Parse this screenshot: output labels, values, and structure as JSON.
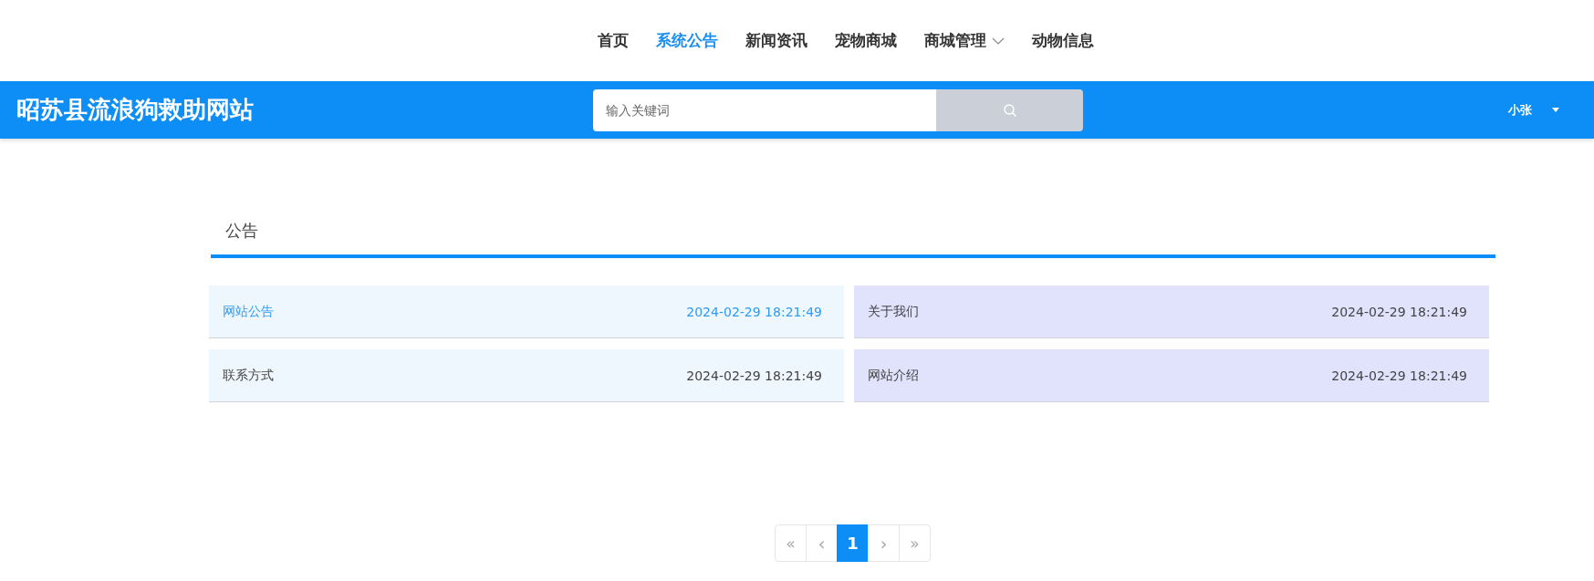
{
  "nav": [
    {
      "label": "首页",
      "selected": false,
      "dropdown": false
    },
    {
      "label": "系统公告",
      "selected": true,
      "dropdown": false
    },
    {
      "label": "新闻资讯",
      "selected": false,
      "dropdown": false
    },
    {
      "label": "宠物商城",
      "selected": false,
      "dropdown": false
    },
    {
      "label": "商城管理",
      "selected": false,
      "dropdown": true
    },
    {
      "label": "动物信息",
      "selected": false,
      "dropdown": false
    }
  ],
  "header": {
    "site_title": "昭苏县流浪狗救助网站",
    "search": {
      "placeholder": "输入关键词"
    },
    "user": "小张"
  },
  "section": {
    "title": "公告"
  },
  "notices": [
    {
      "title": "网站公告",
      "time": "2024-02-29 18:21:49",
      "selected": true
    },
    {
      "title": "关于我们",
      "time": "2024-02-29 18:21:49",
      "selected": false
    },
    {
      "title": "联系方式",
      "time": "2024-02-29 18:21:49",
      "selected": false
    },
    {
      "title": "网站介绍",
      "time": "2024-02-29 18:21:49",
      "selected": false
    }
  ],
  "pagination": [
    {
      "kind": "first",
      "label": "«",
      "selected": false
    },
    {
      "kind": "prev",
      "label": "‹",
      "selected": false
    },
    {
      "kind": "page",
      "label": "1",
      "selected": true
    },
    {
      "kind": "next",
      "label": "›",
      "selected": false
    },
    {
      "kind": "last",
      "label": "»",
      "selected": false
    }
  ]
}
